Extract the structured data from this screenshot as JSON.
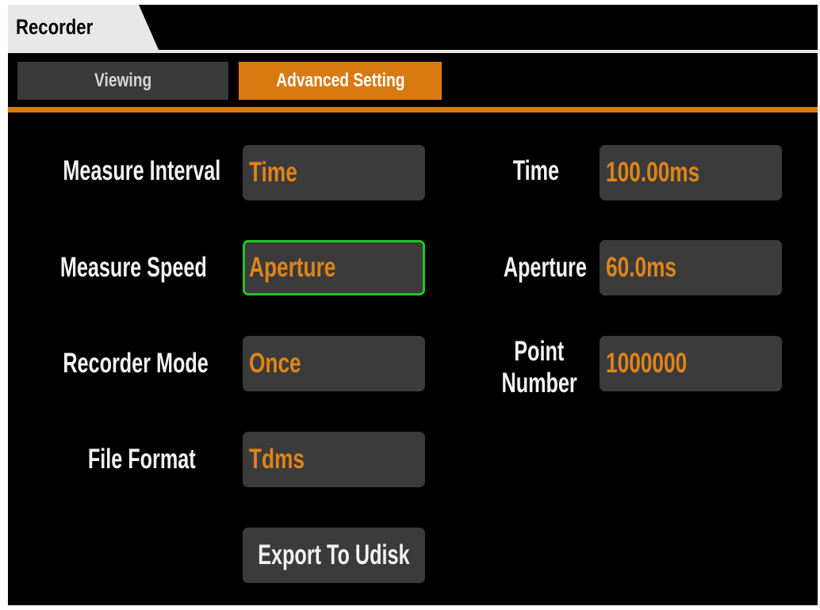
{
  "window": {
    "title": "Recorder"
  },
  "tabs": [
    {
      "label": "Viewing",
      "active": false
    },
    {
      "label": "Advanced Setting",
      "active": true
    }
  ],
  "left_settings": [
    {
      "label": "Measure Interval",
      "value": "Time"
    },
    {
      "label": "Measure Speed",
      "value": "Aperture",
      "focused": true
    },
    {
      "label": "Recorder Mode",
      "value": "Once"
    },
    {
      "label": "File Format",
      "value": "Tdms"
    }
  ],
  "right_settings": [
    {
      "label": "Time",
      "value": "100.00ms"
    },
    {
      "label": "Aperture",
      "value": "60.0ms"
    },
    {
      "label_line1": "Point",
      "label_line2": "Number",
      "value": "1000000"
    }
  ],
  "actions": {
    "export_label": "Export To Udisk"
  },
  "colors": {
    "accent": "#d97a10",
    "value_text": "#e08418",
    "field_bg": "#3b3b3b",
    "focus_border": "#24c224",
    "background": "#000000"
  }
}
